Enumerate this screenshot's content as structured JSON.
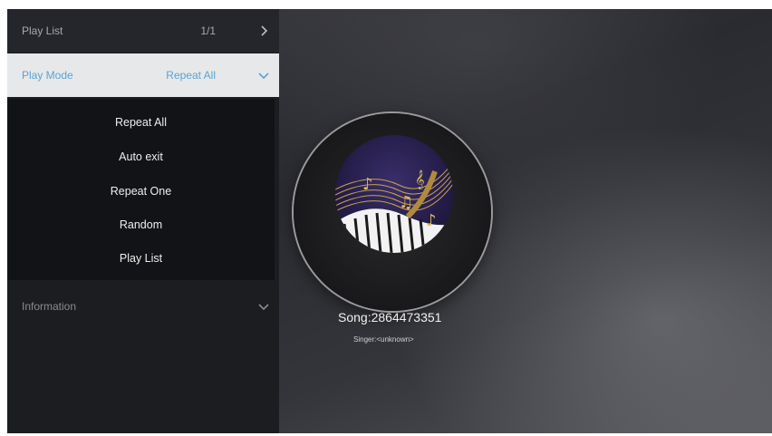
{
  "panel": {
    "play_list": {
      "label": "Play List",
      "value": "1/1"
    },
    "play_mode": {
      "label": "Play Mode",
      "value": "Repeat All"
    },
    "mode_options": [
      "Repeat All",
      "Auto exit",
      "Repeat One",
      "Random",
      "Play List"
    ],
    "information": {
      "label": "Information"
    }
  },
  "now_playing": {
    "song": "Song:2864473351",
    "singer": "Singer:<unknown>"
  },
  "colors": {
    "accent": "#5aa4d2",
    "panel_bg": "#1c1d21",
    "menu_bg": "#121316",
    "selected_row_bg": "#e7e8ea"
  },
  "icons": {
    "play_list_arrow": "chevron-right-icon",
    "play_mode_arrow": "chevron-down-icon",
    "information_arrow": "chevron-down-icon"
  }
}
